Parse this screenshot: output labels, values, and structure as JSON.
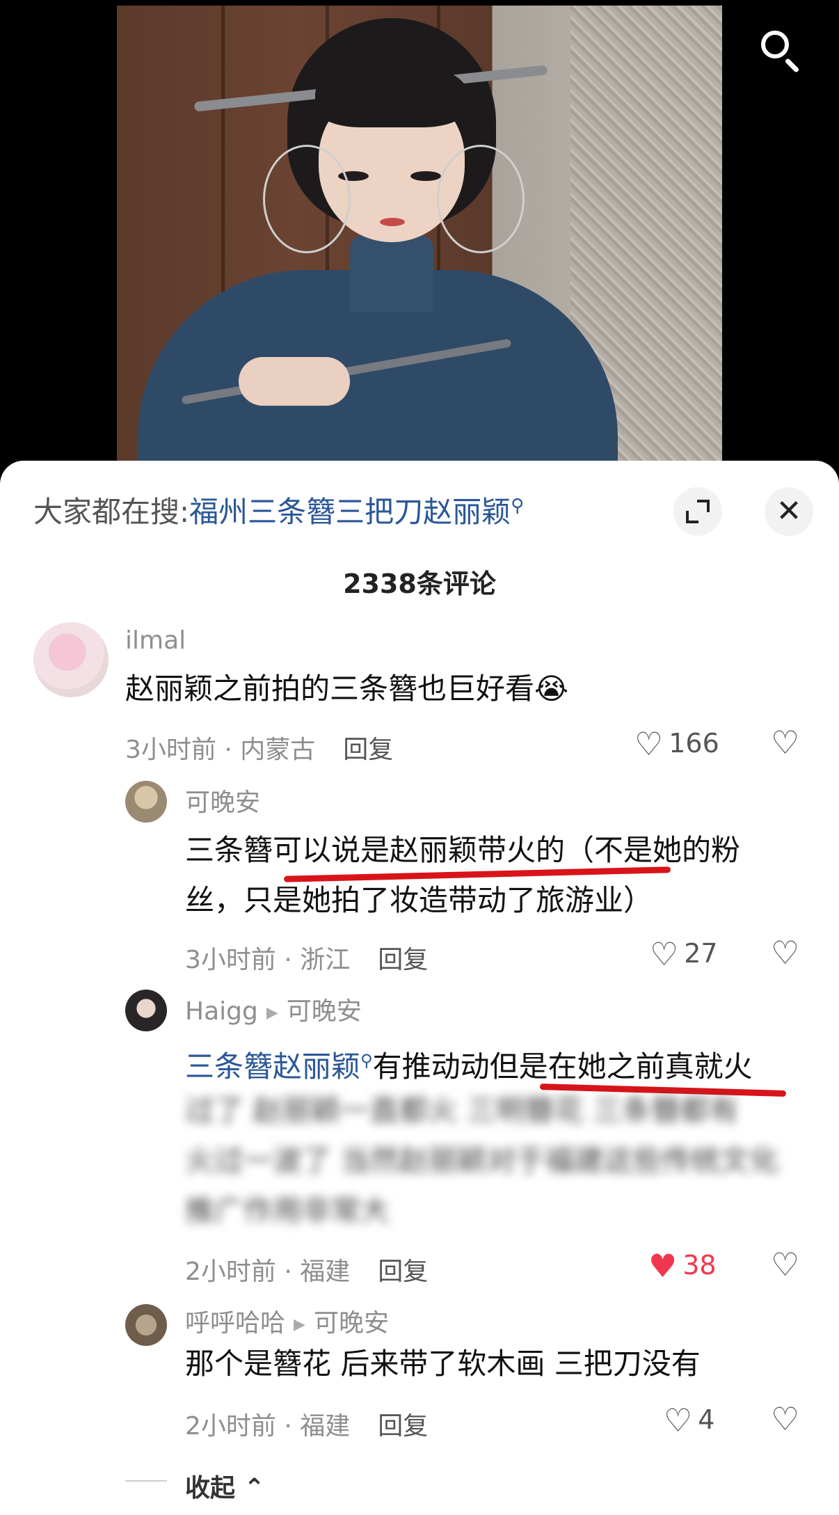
{
  "search_bar": {
    "prefix": "大家都在搜:",
    "query": "福州三条簪三把刀赵丽颖"
  },
  "comment_count": "2338条评论",
  "comments": [
    {
      "user": "ilmal",
      "text": "赵丽颖之前拍的三条簪也巨好看😭",
      "time_location": "3小时前 · 内蒙古",
      "reply_label": "回复",
      "likes": "166",
      "liked": false
    },
    {
      "user": "可晚安",
      "text_line1": "三条簪可以说是赵丽颖带火的（不是她的粉",
      "text_line2": "丝，只是她拍了妆造带动了旅游业）",
      "time_location": "3小时前 · 浙江",
      "reply_label": "回复",
      "likes": "27",
      "liked": false
    },
    {
      "user": "Haigg",
      "reply_to": "可晚安",
      "link_text": "三条簪赵丽颖",
      "text_after_link": "有推动动但是在她之前真就火",
      "text_line2": "过了 赵丽颖一直都火 三明簪花 三条簪都有",
      "text_line3": "火过一波了 当然赵丽颖对于福建这些传统文化",
      "text_line4": "推广作用非常大",
      "time_location": "2小时前 · 福建",
      "reply_label": "回复",
      "likes": "38",
      "liked": true
    },
    {
      "user": "呼呼哈哈",
      "reply_to": "可晚安",
      "text": "那个是簪花 后来带了软木画 三把刀没有",
      "time_location": "2小时前 · 福建",
      "reply_label": "回复",
      "likes": "4",
      "liked": false
    }
  ],
  "collapse_label": "收起",
  "colors": {
    "link": "#2b5797",
    "liked": "#f0374f",
    "annotation_line": "#d8141a"
  }
}
